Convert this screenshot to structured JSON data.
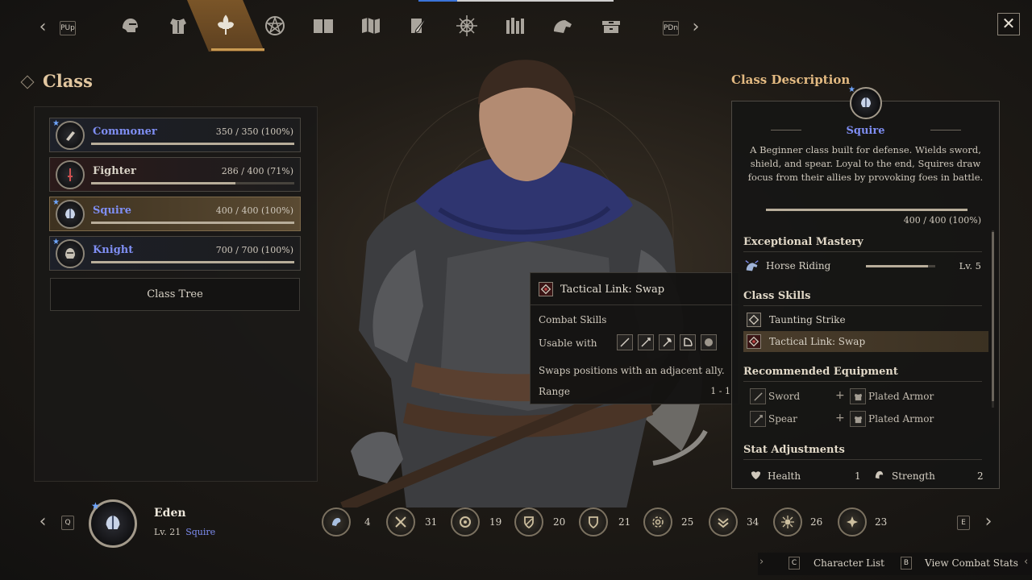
{
  "colors": {
    "accent_gold": "#e2b981",
    "class_blue": "#7f8ef3",
    "active_nav": "#c99a52",
    "progress_blue": "#3a73d9"
  },
  "topnav": {
    "prev_key": "PUp",
    "next_key": "PDn",
    "icons": [
      "helmet-icon",
      "armor-icon",
      "fleur-de-lis-icon",
      "pentagram-icon",
      "book-icon",
      "map-icon",
      "quill-icon",
      "compass-icon",
      "library-icon",
      "horse-icon",
      "chest-icon"
    ],
    "active_index": 2,
    "progress": 0.2
  },
  "class_panel": {
    "title": "Class",
    "classes": [
      {
        "name": "Commoner",
        "exp": "350 / 350 (100%)",
        "progress": 1.0
      },
      {
        "name": "Fighter",
        "exp": "286 / 400 (71%)",
        "progress": 0.71
      },
      {
        "name": "Squire",
        "exp": "400 / 400 (100%)",
        "progress": 1.0
      },
      {
        "name": "Knight",
        "exp": "700 / 700 (100%)",
        "progress": 1.0
      }
    ],
    "class_tree_label": "Class Tree"
  },
  "tooltip": {
    "title": "Tactical Link: Swap",
    "category": "Combat Skills",
    "usable_label": "Usable with",
    "usable_weapons": [
      "sword-icon",
      "spear-icon",
      "axe-icon",
      "bow-icon",
      "shield-icon"
    ],
    "description": "Swaps positions with an adjacent ally.",
    "range_label": "Range",
    "range_value": "1 - 1"
  },
  "description": {
    "header": "Class Description",
    "class_name": "Squire",
    "text": "A Beginner class built for defense. Wields sword, shield, and spear. Loyal to the end, Squires draw focus from their allies by provoking foes in battle.",
    "exp": "400 / 400 (100%)",
    "mastery_title": "Exceptional Mastery",
    "mastery": {
      "name": "Horse Riding",
      "level": "Lv.  5",
      "progress": 0.9
    },
    "skills_title": "Class Skills",
    "skills": [
      "Taunting Strike",
      "Tactical Link: Swap"
    ],
    "equipment_title": "Recommended Equipment",
    "equipment": [
      {
        "weapon": "Sword",
        "armor": "Plated Armor"
      },
      {
        "weapon": "Spear",
        "armor": "Plated Armor"
      }
    ],
    "stats_title": "Stat Adjustments",
    "stats": [
      {
        "name": "Health",
        "value": "1"
      },
      {
        "name": "Strength",
        "value": "2"
      }
    ]
  },
  "character": {
    "prev_key": "Q",
    "next_key": "E",
    "name": "Eden",
    "level": "Lv. 21",
    "class": "Squire",
    "stats": [
      "4",
      "31",
      "19",
      "20",
      "21",
      "25",
      "34",
      "26",
      "23"
    ]
  },
  "footer": {
    "character_list_key": "C",
    "character_list_label": "Character List",
    "combat_stats_key": "B",
    "combat_stats_label": "View Combat Stats"
  }
}
